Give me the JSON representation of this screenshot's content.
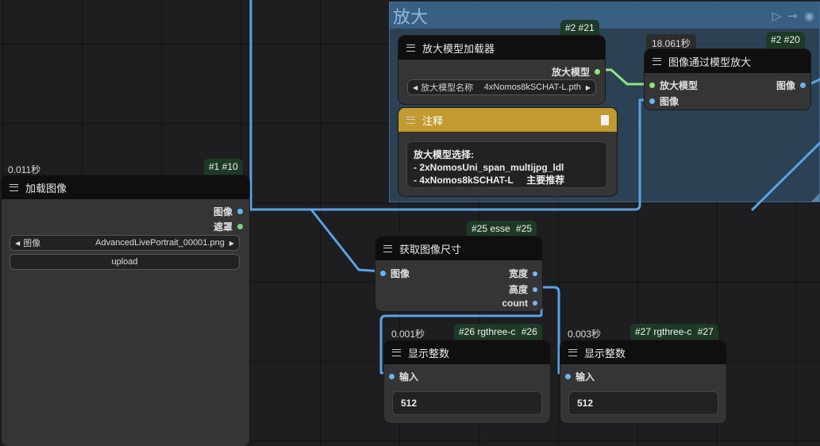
{
  "group": {
    "title": "放大"
  },
  "nodes": {
    "load_image": {
      "exec_time": "0.011秒",
      "badge": "#1 #10",
      "title": "加载图像",
      "outputs": [
        "图像",
        "遮罩"
      ],
      "widget_label": "图像",
      "widget_value": "AdvancedLivePortrait_00001.png",
      "upload_label": "upload"
    },
    "upscale_loader": {
      "badge": "#2 #21",
      "title": "放大模型加载器",
      "output": "放大模型",
      "widget_label": "放大模型名称",
      "widget_value": "4xNomos8kSCHAT-L.pth"
    },
    "upscale_with_model": {
      "exec_time": "18.061秒",
      "badge": "#2 #20",
      "title": "图像通过模型放大",
      "inputs": [
        "放大模型",
        "图像"
      ],
      "output": "图像"
    },
    "note": {
      "title": "注释",
      "lines": [
        "放大模型选择:",
        "- 2xNomosUni_span_multijpg_ldl",
        "- 4xNomos8kSCHAT-L     主要推荐"
      ]
    },
    "get_image_size": {
      "badge_left": "#25 esse",
      "badge_right": "#25",
      "title": "获取图像尺寸",
      "input": "图像",
      "outputs": [
        "宽度",
        "高度",
        "count"
      ]
    },
    "display_int_1": {
      "exec_time": "0.001秒",
      "badge_left": "#26 rgthree-c",
      "badge_right": "#26",
      "title": "显示整数",
      "input": "输入",
      "value": "512"
    },
    "display_int_2": {
      "exec_time": "0.003秒",
      "badge_left": "#27 rgthree-c",
      "badge_right": "#27",
      "title": "显示整数",
      "input": "输入",
      "value": "512"
    }
  },
  "colors": {
    "wire_image": "#5aa2e6",
    "wire_model": "#8de57a",
    "group_fill": "#3a5f80",
    "note_header": "#c29a30"
  }
}
